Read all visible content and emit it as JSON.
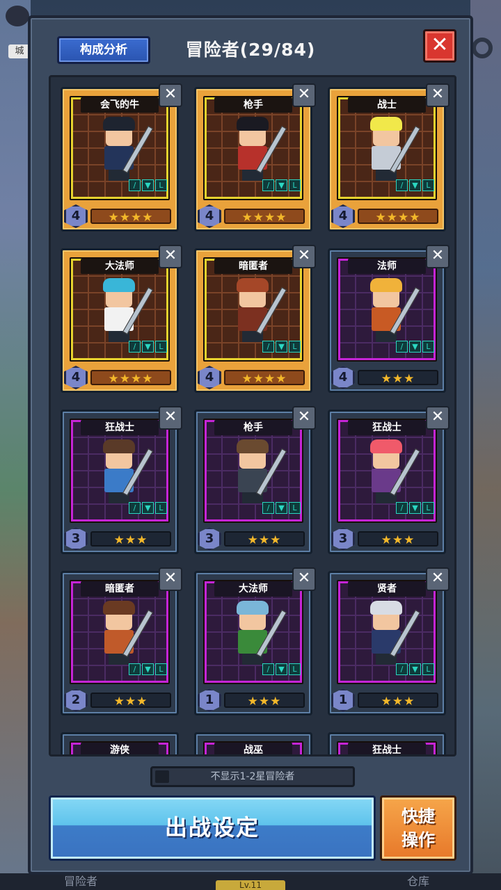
{
  "background": {
    "top_left_label": "城",
    "bottom_left": "冒险者",
    "bottom_center": "Lv.11",
    "bottom_right": "仓库"
  },
  "header": {
    "analysis_button": "构成分析",
    "title": "冒险者(29/84)",
    "close_label": "✕"
  },
  "cards": [
    {
      "name": "会飞的牛",
      "level": "4",
      "stars": "★★★★",
      "frame": "gold",
      "hair": "#1e2430",
      "body": "#23345a"
    },
    {
      "name": "枪手",
      "level": "4",
      "stars": "★★★★",
      "frame": "gold",
      "hair": "#1a1a22",
      "body": "#b7312b"
    },
    {
      "name": "战士",
      "level": "4",
      "stars": "★★★★",
      "frame": "gold",
      "hair": "#f1e84a",
      "body": "#c5ccd6"
    },
    {
      "name": "大法师",
      "level": "4",
      "stars": "★★★★",
      "frame": "gold",
      "hair": "#39b6d8",
      "body": "#f2f2f2"
    },
    {
      "name": "暗匿者",
      "level": "4",
      "stars": "★★★★",
      "frame": "gold",
      "hair": "#a54728",
      "body": "#7c3020"
    },
    {
      "name": "法师",
      "level": "4",
      "stars": "★★★",
      "frame": "steel",
      "hair": "#f0b23a",
      "body": "#c85a24"
    },
    {
      "name": "狂战士",
      "level": "3",
      "stars": "★★★",
      "frame": "steel",
      "hair": "#5a3a28",
      "body": "#3b7bc8"
    },
    {
      "name": "枪手",
      "level": "3",
      "stars": "★★★",
      "frame": "steel",
      "hair": "#6a4a30",
      "body": "#3a4452"
    },
    {
      "name": "狂战士",
      "level": "3",
      "stars": "★★★",
      "frame": "steel",
      "hair": "#f05a6a",
      "body": "#6a3a8a"
    },
    {
      "name": "暗匿者",
      "level": "2",
      "stars": "★★★",
      "frame": "steel",
      "hair": "#6a3a22",
      "body": "#c05a2a"
    },
    {
      "name": "大法师",
      "level": "1",
      "stars": "★★★",
      "frame": "steel",
      "hair": "#7ab6d8",
      "body": "#3a8a3a"
    },
    {
      "name": "贤者",
      "level": "1",
      "stars": "★★★",
      "frame": "steel",
      "hair": "#d8dce4",
      "body": "#2a3a6a"
    }
  ],
  "partial_cards": [
    "游侠",
    "战巫",
    "狂战士"
  ],
  "filter": {
    "label": "不显示1-2星冒险者"
  },
  "footer": {
    "deploy_button": "出战设定",
    "quick_line1": "快捷",
    "quick_line2": "操作"
  },
  "equip_icons": [
    "/",
    "▼",
    "L"
  ],
  "swords_icon": "✕"
}
